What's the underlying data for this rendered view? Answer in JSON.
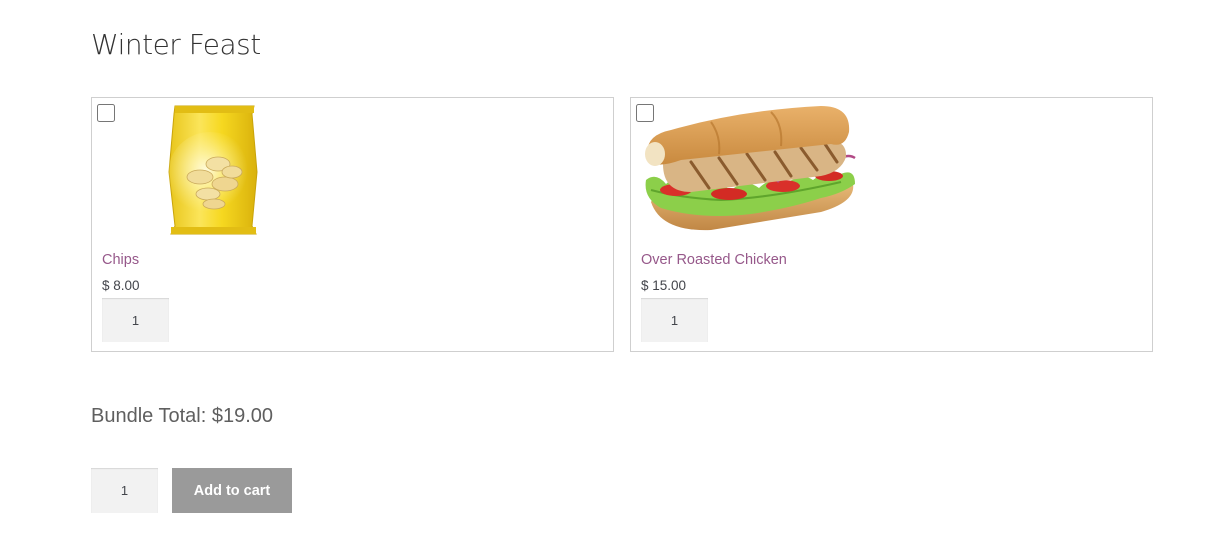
{
  "page": {
    "title": "Winter Feast"
  },
  "products": [
    {
      "name": "Chips",
      "price": "$ 8.00",
      "quantity": "1",
      "image_icon": "chips-bag-image"
    },
    {
      "name": "Over Roasted Chicken",
      "price": "$ 15.00",
      "quantity": "1",
      "image_icon": "chicken-sandwich-image"
    }
  ],
  "bundle": {
    "total_label": "Bundle Total: $19.00",
    "quantity": "1",
    "add_to_cart_label": "Add to cart"
  },
  "colors": {
    "link": "#96588a",
    "button": "#9a9a9a",
    "qty_background": "#f2f2f2",
    "card_border": "#cfcfcf"
  }
}
